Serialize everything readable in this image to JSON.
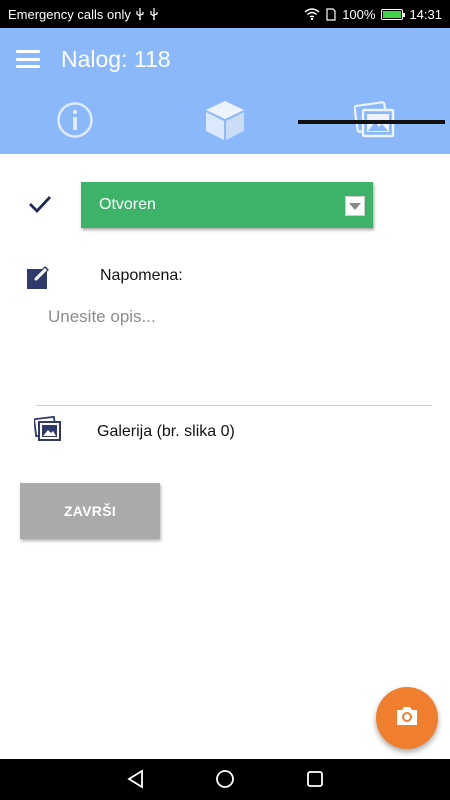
{
  "status_bar": {
    "carrier": "Emergency calls only",
    "battery_percent": "100%",
    "time": "14:31",
    "battery_level": 1.0,
    "icons": [
      "usb-icon",
      "usb-icon",
      "wifi-icon",
      "sim-icon",
      "battery-icon"
    ]
  },
  "app_bar": {
    "title": "Nalog: 118",
    "background_color": "#8ab8fb",
    "tabs": [
      {
        "name": "info-icon",
        "selected": false
      },
      {
        "name": "cube-icon",
        "selected": false
      },
      {
        "name": "gallery-icon",
        "selected": true
      }
    ]
  },
  "form": {
    "status_value": "Otvoren",
    "status_color": "#3db36a",
    "note_label": "Napomena:",
    "note_value": "",
    "note_placeholder": "Unesite opis...",
    "gallery_label": "Galerija (br. slika 0)",
    "finish_label": "ZAVRŠI"
  },
  "fab": {
    "icon": "camera-icon",
    "color": "#ef7f2e"
  },
  "nav_bar": {
    "buttons": [
      "back-icon",
      "home-icon",
      "recents-icon"
    ]
  }
}
